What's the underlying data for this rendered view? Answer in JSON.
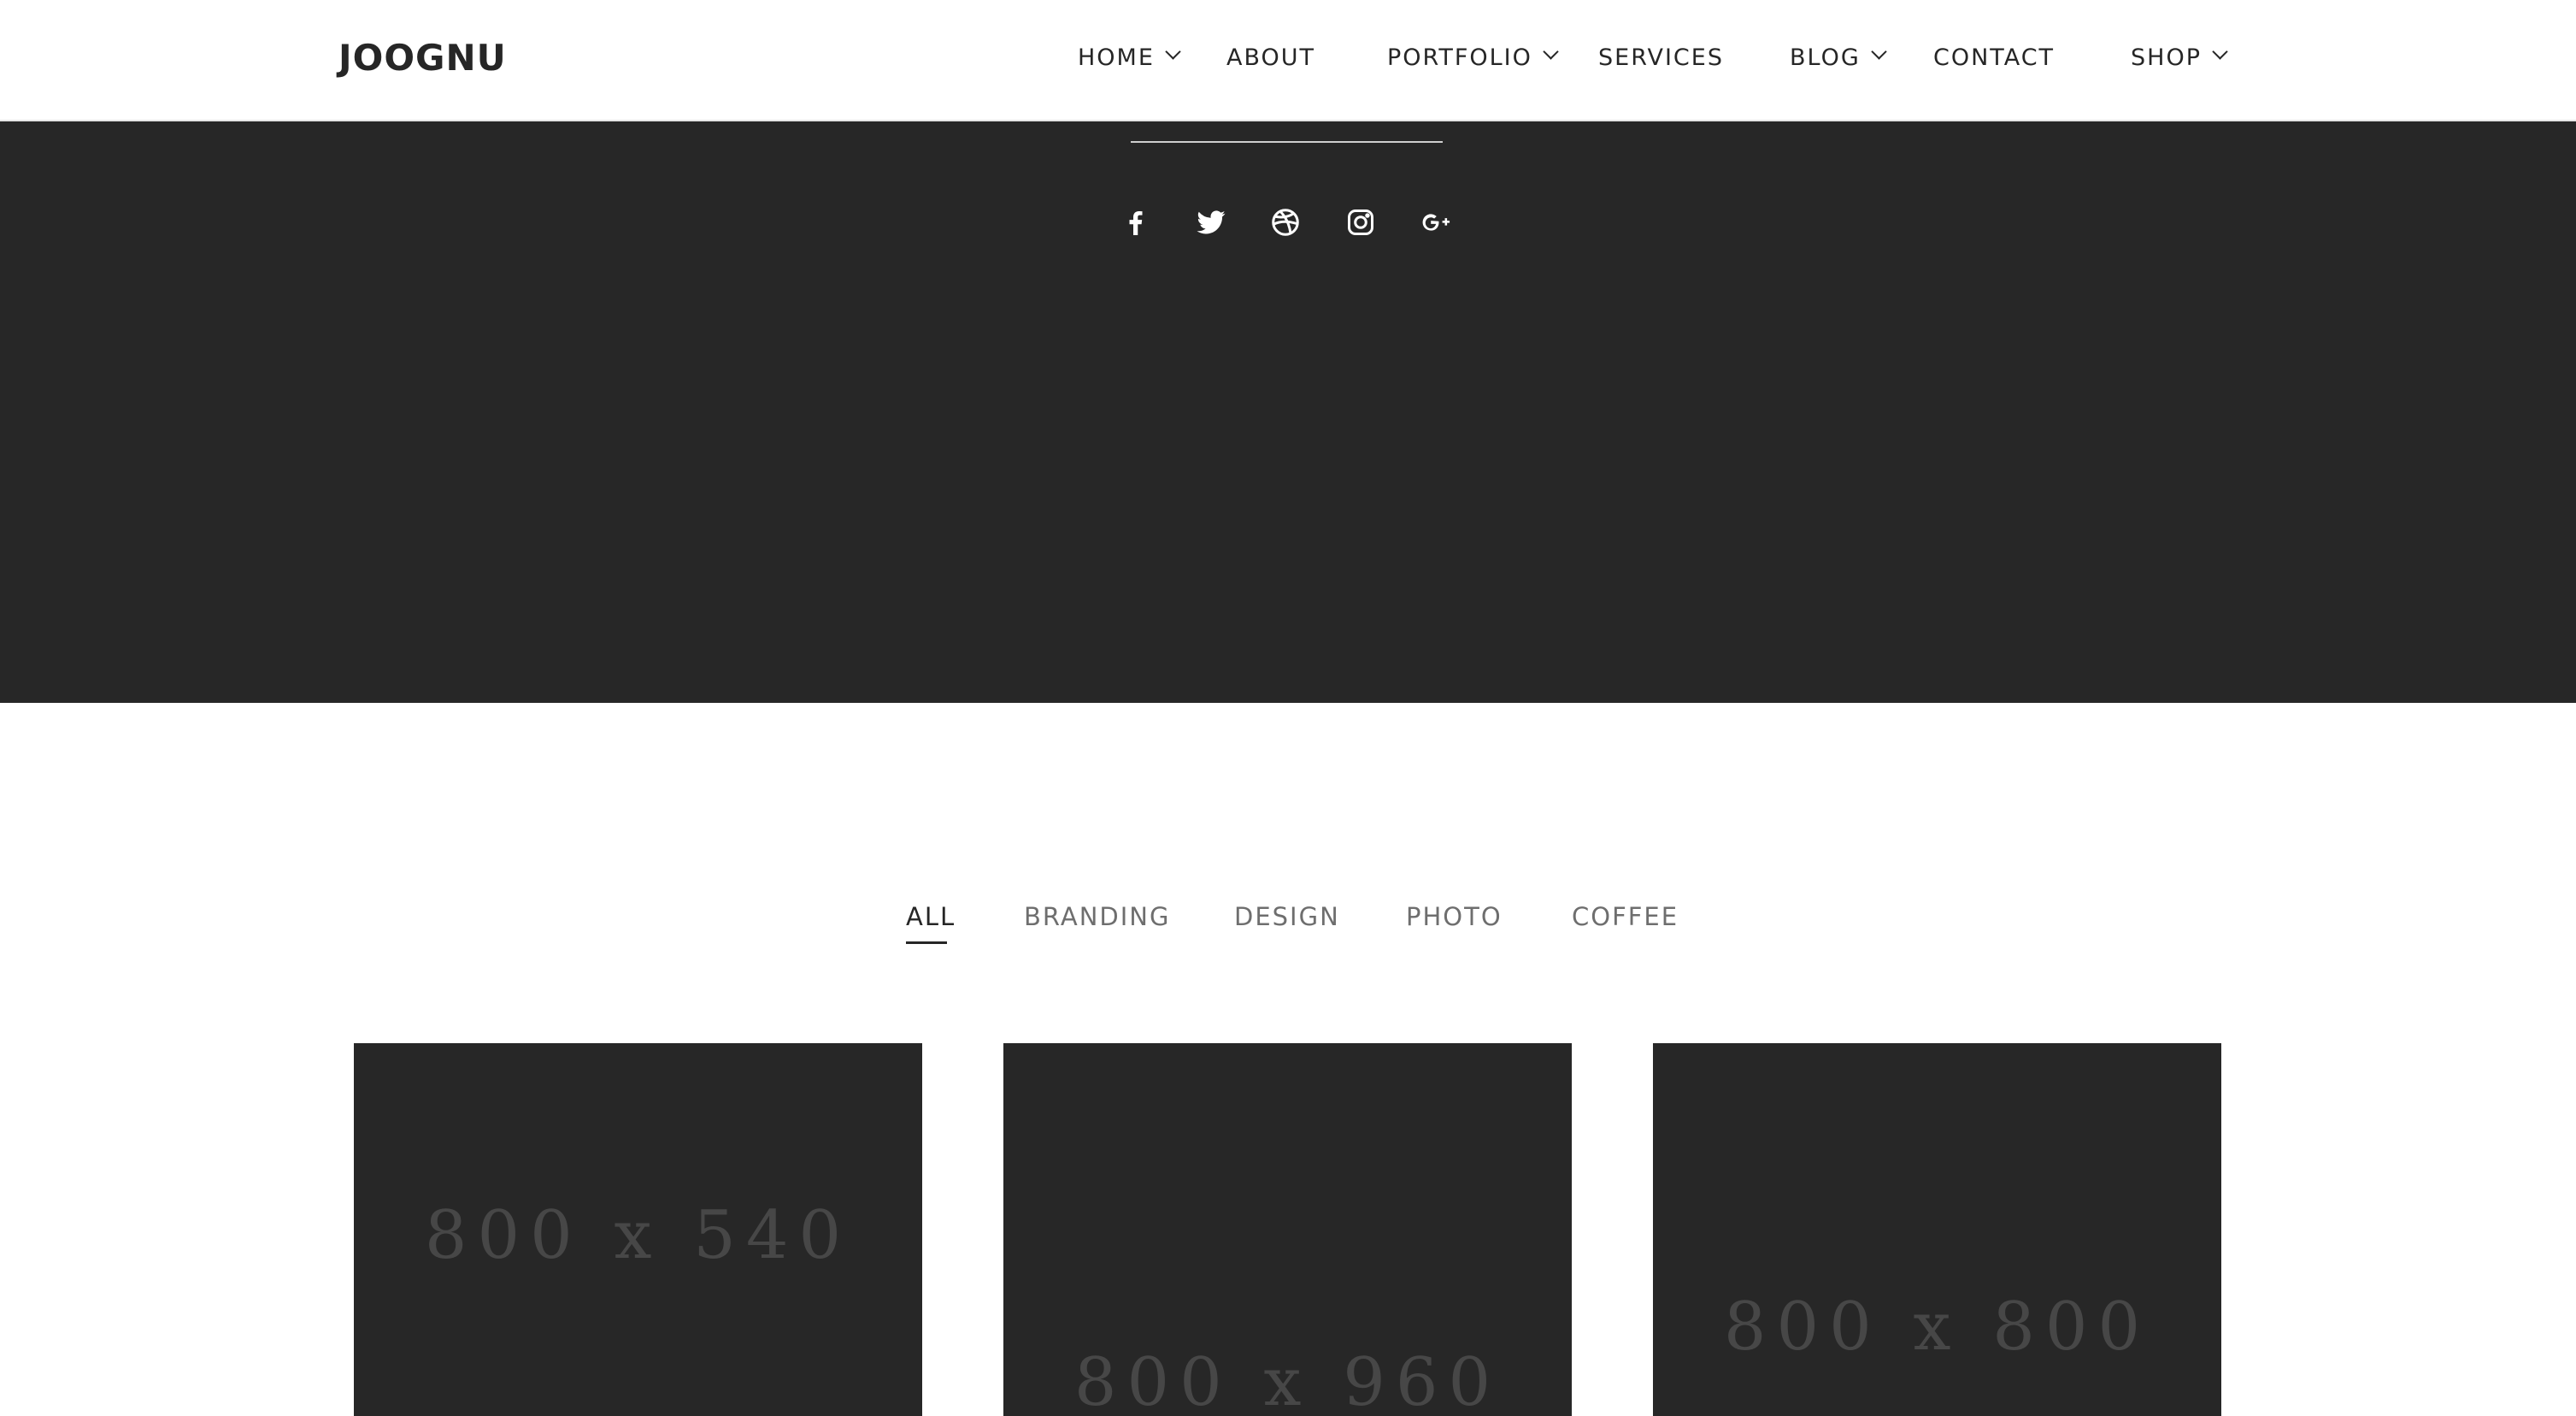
{
  "header": {
    "logo": "JOOGNU",
    "nav": [
      {
        "label": "HOME",
        "has_dropdown": true
      },
      {
        "label": "ABOUT",
        "has_dropdown": false
      },
      {
        "label": "PORTFOLIO",
        "has_dropdown": true
      },
      {
        "label": "SERVICES",
        "has_dropdown": false
      },
      {
        "label": "BLOG",
        "has_dropdown": true
      },
      {
        "label": "CONTACT",
        "has_dropdown": false
      },
      {
        "label": "SHOP",
        "has_dropdown": true
      }
    ]
  },
  "hero": {
    "background_color": "#272727",
    "social_icons": [
      "facebook-icon",
      "twitter-icon",
      "dribbble-icon",
      "instagram-icon",
      "google-plus-icon"
    ]
  },
  "filters": {
    "items": [
      "ALL",
      "BRANDING",
      "DESIGN",
      "PHOTO",
      "COFFEE"
    ],
    "active": "ALL"
  },
  "portfolio": {
    "items": [
      {
        "placeholder": "800 x 540"
      },
      {
        "placeholder": "800 x 960"
      },
      {
        "placeholder": "800 x 800"
      }
    ]
  }
}
